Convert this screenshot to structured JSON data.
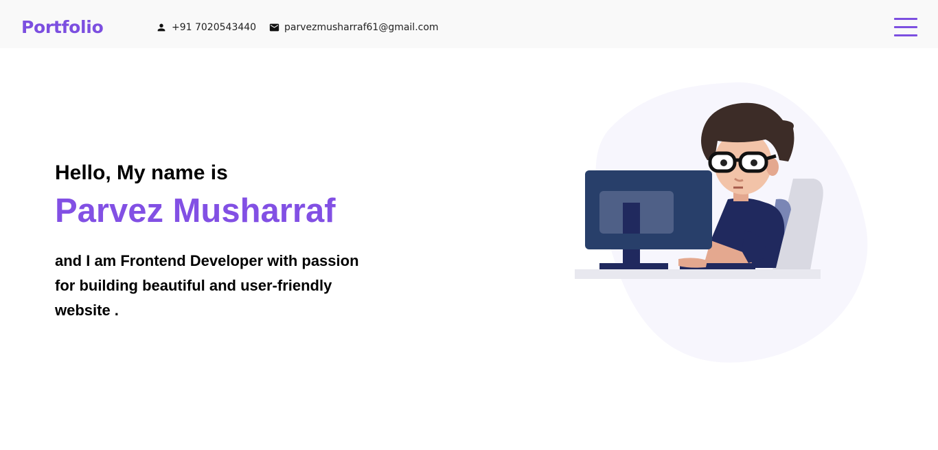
{
  "header": {
    "logo": "Portfolio",
    "phone": "+91 7020543440",
    "email": "parvezmusharraf61@gmail.com",
    "menu_icon": "hamburger-menu-icon"
  },
  "hero": {
    "greeting": "Hello, My name is",
    "name": "Parvez Musharraf",
    "tagline": "and I am Frontend Developer with passion for building beautiful and user-friendly website ."
  },
  "illustration": {
    "subject": "developer-at-computer-illustration"
  },
  "colors": {
    "accent": "#8250e4",
    "header_bg": "#f9f9f9",
    "text": "#000000"
  }
}
